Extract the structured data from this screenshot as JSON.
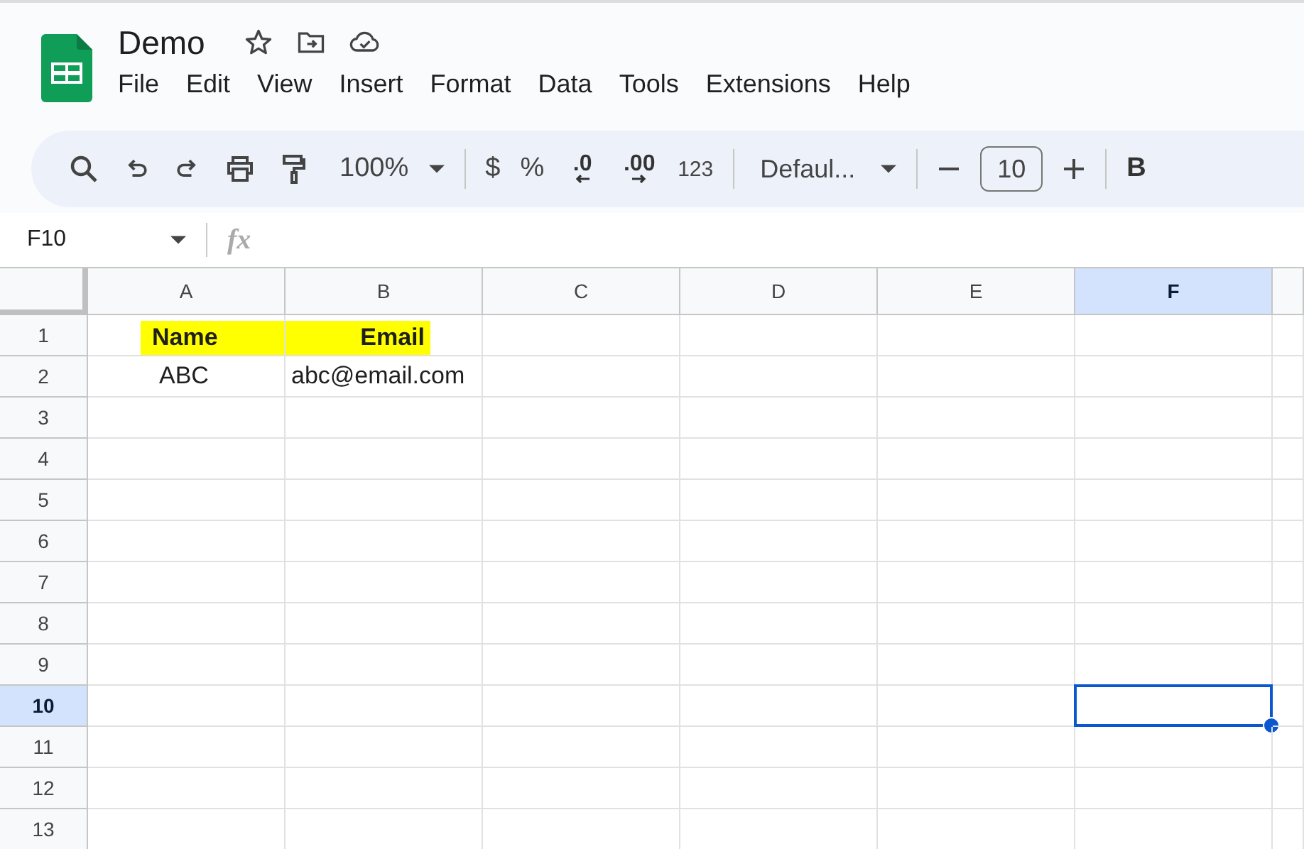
{
  "document": {
    "title": "Demo"
  },
  "menu": [
    "File",
    "Edit",
    "View",
    "Insert",
    "Format",
    "Data",
    "Tools",
    "Extensions",
    "Help"
  ],
  "toolbar": {
    "zoom": "100%",
    "currency": "$",
    "percent": "%",
    "decrease_decimal": ".0",
    "increase_decimal": ".00",
    "number_format": "123",
    "font": "Defaul...",
    "font_size": "10",
    "bold": "B"
  },
  "name_box": "F10",
  "formula_label": "fx",
  "columns": [
    {
      "label": "A",
      "selected": false
    },
    {
      "label": "B",
      "selected": false
    },
    {
      "label": "C",
      "selected": false
    },
    {
      "label": "D",
      "selected": false
    },
    {
      "label": "E",
      "selected": false
    },
    {
      "label": "F",
      "selected": true
    }
  ],
  "rows": [
    {
      "label": "1",
      "selected": false,
      "cells": [
        {
          "text": "Name",
          "bold": true,
          "highlight": true,
          "right_aligned": false
        },
        {
          "text": "Email",
          "bold": true,
          "highlight": true,
          "right_aligned": true
        },
        {},
        {},
        {},
        {}
      ]
    },
    {
      "label": "2",
      "selected": false,
      "cells": [
        {
          "text": "ABC",
          "bold": false,
          "highlight": false,
          "right_aligned": false
        },
        {
          "text": "abc@email.com",
          "bold": false,
          "highlight": false,
          "right_aligned": false
        },
        {},
        {},
        {},
        {}
      ]
    },
    {
      "label": "3",
      "selected": false,
      "cells": [
        {},
        {},
        {},
        {},
        {},
        {}
      ]
    },
    {
      "label": "4",
      "selected": false,
      "cells": [
        {},
        {},
        {},
        {},
        {},
        {}
      ]
    },
    {
      "label": "5",
      "selected": false,
      "cells": [
        {},
        {},
        {},
        {},
        {},
        {}
      ]
    },
    {
      "label": "6",
      "selected": false,
      "cells": [
        {},
        {},
        {},
        {},
        {},
        {}
      ]
    },
    {
      "label": "7",
      "selected": false,
      "cells": [
        {},
        {},
        {},
        {},
        {},
        {}
      ]
    },
    {
      "label": "8",
      "selected": false,
      "cells": [
        {},
        {},
        {},
        {},
        {},
        {}
      ]
    },
    {
      "label": "9",
      "selected": false,
      "cells": [
        {},
        {},
        {},
        {},
        {},
        {}
      ]
    },
    {
      "label": "10",
      "selected": true,
      "cells": [
        {},
        {},
        {},
        {},
        {},
        {
          "selected": true
        }
      ]
    },
    {
      "label": "11",
      "selected": false,
      "cells": [
        {},
        {},
        {},
        {},
        {},
        {}
      ]
    },
    {
      "label": "12",
      "selected": false,
      "cells": [
        {},
        {},
        {},
        {},
        {},
        {}
      ]
    },
    {
      "label": "13",
      "selected": false,
      "cells": [
        {},
        {},
        {},
        {},
        {},
        {}
      ]
    }
  ]
}
